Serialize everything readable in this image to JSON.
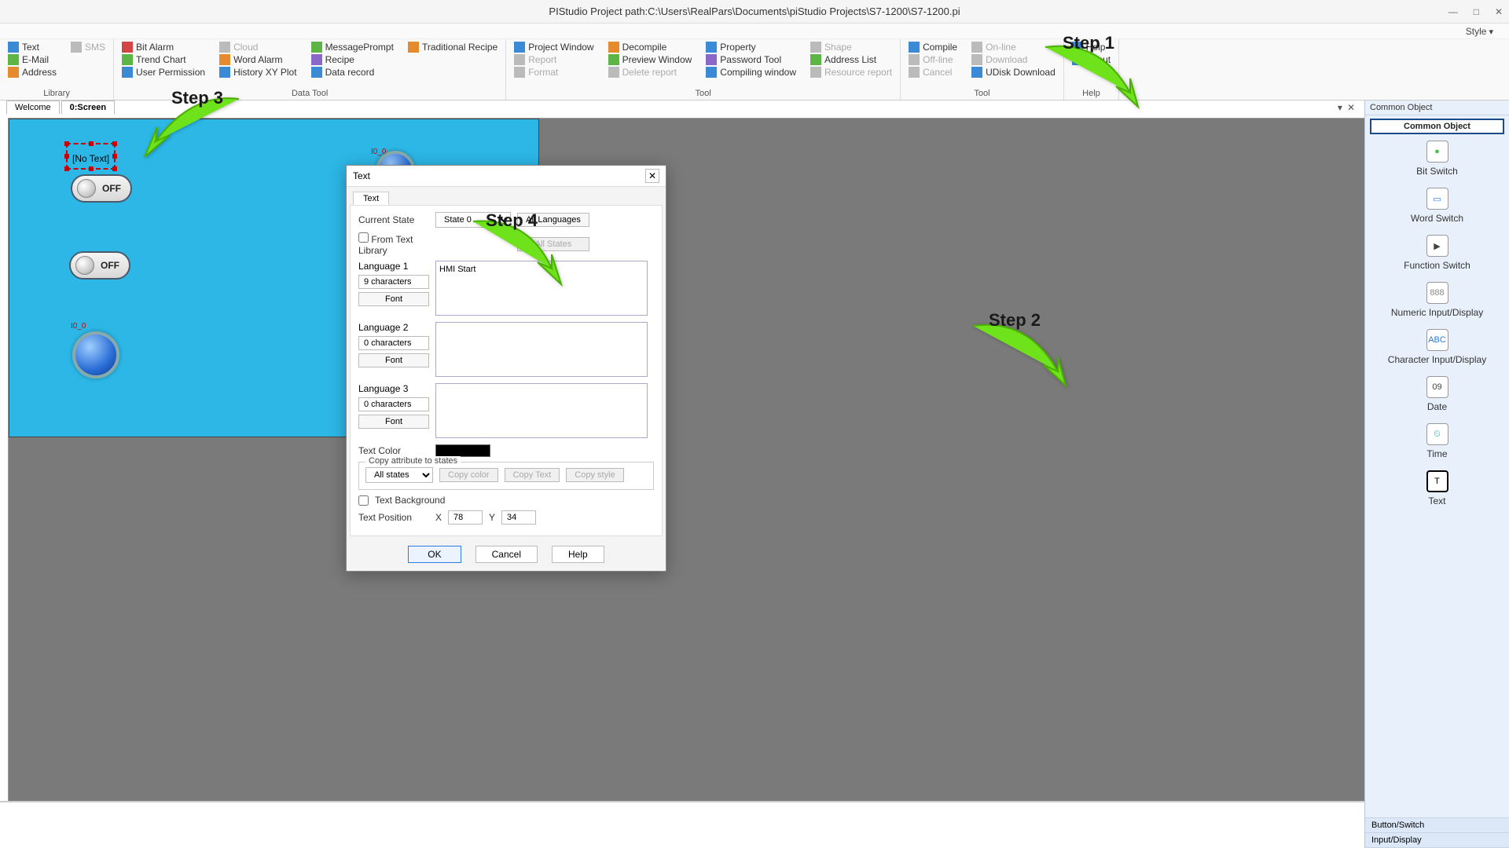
{
  "title": "PIStudio   Project path:C:\\Users\\RealPars\\Documents\\piStudio Projects\\S7-1200\\S7-1200.pi",
  "style_label": "Style",
  "ribbon": {
    "groups": [
      {
        "label": "Library",
        "items": [
          {
            "text": "Text",
            "ic": "ic-blue"
          },
          {
            "text": "E-Mail",
            "ic": "ic-green"
          },
          {
            "text": "Address",
            "ic": "ic-orange"
          },
          {
            "text": "SMS",
            "disabled": true,
            "ic": "ic-gray"
          }
        ]
      },
      {
        "label": "Data Tool",
        "items": [
          {
            "text": "Bit Alarm",
            "ic": "ic-red"
          },
          {
            "text": "Trend Chart",
            "ic": "ic-green"
          },
          {
            "text": "User Permission",
            "ic": "ic-blue"
          },
          {
            "text": "Cloud",
            "disabled": true,
            "ic": "ic-gray"
          },
          {
            "text": "Word Alarm",
            "ic": "ic-orange"
          },
          {
            "text": "History XY Plot",
            "ic": "ic-blue"
          },
          {
            "text": "MessagePrompt",
            "ic": "ic-green"
          },
          {
            "text": "Recipe",
            "ic": "ic-purple"
          },
          {
            "text": "Data record",
            "ic": "ic-blue"
          },
          {
            "text": "Traditional Recipe",
            "ic": "ic-orange"
          }
        ]
      },
      {
        "label": "Tool",
        "items": [
          {
            "text": "Project Window",
            "ic": "ic-blue"
          },
          {
            "text": "Report",
            "disabled": true,
            "ic": "ic-gray"
          },
          {
            "text": "Format",
            "disabled": true,
            "ic": "ic-gray"
          },
          {
            "text": "Decompile",
            "ic": "ic-orange"
          },
          {
            "text": "Preview Window",
            "ic": "ic-green"
          },
          {
            "text": "Delete report",
            "disabled": true,
            "ic": "ic-gray"
          },
          {
            "text": "Property",
            "ic": "ic-blue"
          },
          {
            "text": "Password Tool",
            "ic": "ic-purple"
          },
          {
            "text": "Compiling window",
            "ic": "ic-blue"
          },
          {
            "text": "Shape",
            "disabled": true,
            "ic": "ic-gray"
          },
          {
            "text": "Address List",
            "ic": "ic-green"
          },
          {
            "text": "Resource report",
            "disabled": true,
            "ic": "ic-gray"
          }
        ]
      },
      {
        "label": "Tool",
        "items": [
          {
            "text": "Compile",
            "ic": "ic-blue"
          },
          {
            "text": "Off-line",
            "disabled": true,
            "ic": "ic-gray"
          },
          {
            "text": "Cancel",
            "disabled": true,
            "ic": "ic-gray"
          },
          {
            "text": "On-line",
            "disabled": true,
            "ic": "ic-gray"
          },
          {
            "text": "Download",
            "disabled": true,
            "ic": "ic-gray"
          },
          {
            "text": "UDisk Download",
            "ic": "ic-blue"
          }
        ]
      },
      {
        "label": "Help",
        "items": [
          {
            "text": "Help",
            "ic": "ic-blue"
          },
          {
            "text": "About",
            "ic": "ic-blue"
          }
        ]
      }
    ]
  },
  "tabs": {
    "welcome": "Welcome",
    "screen": "0:Screen"
  },
  "canvas": {
    "notext": "[No Text]",
    "off1": "OFF",
    "off2": "OFF",
    "lbl_round1": "I0_0",
    "lbl_round2": "I0_0"
  },
  "right_panel": {
    "title": "Common Object",
    "sub": "Common Object",
    "items": [
      {
        "label": "Bit Switch",
        "glyph": "●",
        "color": "#4cc24c"
      },
      {
        "label": "Word Switch",
        "glyph": "▭",
        "color": "#2a7adf"
      },
      {
        "label": "Function Switch",
        "glyph": "▶",
        "color": "#444"
      },
      {
        "label": "Numeric Input/Display",
        "glyph": "888",
        "color": "#888"
      },
      {
        "label": "Character Input/Display",
        "glyph": "ABC",
        "color": "#2a7adf"
      },
      {
        "label": "Date",
        "glyph": "09",
        "color": "#444"
      },
      {
        "label": "Time",
        "glyph": "⏲",
        "color": "#2aa"
      },
      {
        "label": "Text",
        "glyph": "T",
        "color": "#000",
        "selected": true
      }
    ],
    "footer": [
      "Button/Switch",
      "Input/Display"
    ]
  },
  "dialog": {
    "title": "Text",
    "tab": "Text",
    "current_state": "Current State",
    "state_val": "State 0",
    "all_languages": "All Languages",
    "all_states": "All States",
    "from_text_library": "From Text Library",
    "lang1": "Language 1",
    "lang1_chars": "9 characters",
    "lang1_text": "HMI Start",
    "lang2": "Language 2",
    "lang2_chars": "0 characters",
    "lang2_text": "",
    "lang3": "Language 3",
    "lang3_chars": "0 characters",
    "lang3_text": "",
    "font_btn": "Font",
    "text_color": "Text Color",
    "copy_legend": "Copy attribute to states",
    "copy_sel": "All states",
    "copy_color": "Copy color",
    "copy_text": "Copy Text",
    "copy_style": "Copy style",
    "text_bg": "Text Background",
    "text_pos": "Text Position",
    "x": "X",
    "y": "Y",
    "xv": "78",
    "yv": "34",
    "ok": "OK",
    "cancel": "Cancel",
    "help": "Help"
  },
  "steps": {
    "s1": "Step 1",
    "s2": "Step 2",
    "s3": "Step 3",
    "s4": "Step 4"
  }
}
